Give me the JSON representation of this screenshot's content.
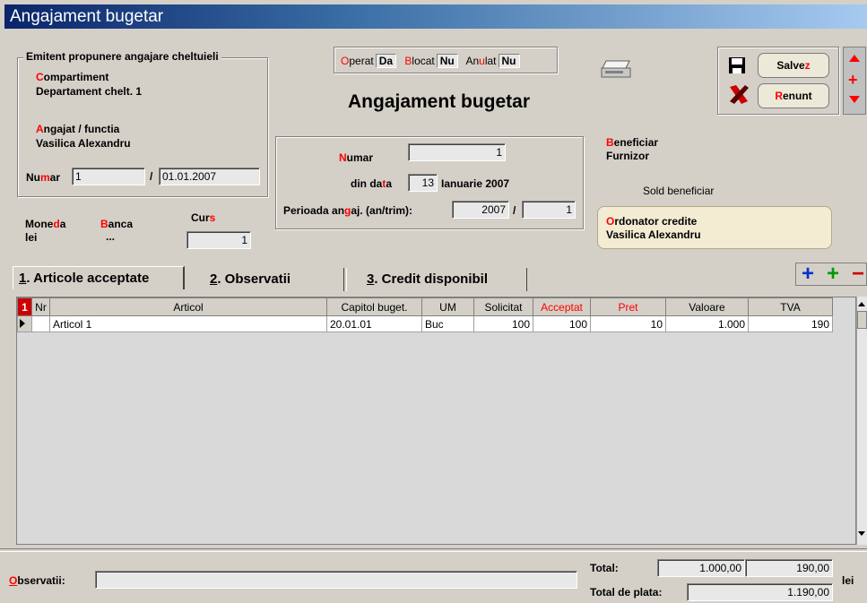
{
  "window": {
    "title": "Angajament bugetar"
  },
  "emitent": {
    "legend": "Emitent propunere angajare cheltuieli",
    "compartiment_label": [
      "C",
      "ompartiment"
    ],
    "compartiment_value": "Departament chelt. 1",
    "angajat_label": [
      "A",
      "ngajat / functia"
    ],
    "angajat_value": "Vasilica Alexandru",
    "numar_label": [
      "Nu",
      "m",
      "ar"
    ],
    "numar_value": "1",
    "data_value": "01.01.2007"
  },
  "moneda": {
    "label": [
      "Mone",
      "d",
      "a"
    ],
    "value": "lei"
  },
  "banca": {
    "label": [
      "B",
      "anca"
    ],
    "value": "..."
  },
  "curs": {
    "label": [
      "Cur",
      "s"
    ],
    "value": "1"
  },
  "status": {
    "operat": {
      "label": [
        "O",
        "perat"
      ],
      "value": "Da"
    },
    "blocat": {
      "label": [
        "B",
        "locat"
      ],
      "value": "Nu"
    },
    "anulat": {
      "label": [
        "An",
        "u",
        "lat"
      ],
      "value": "Nu"
    }
  },
  "header": {
    "title": "Angajament bugetar"
  },
  "document": {
    "numar_label": [
      "N",
      "umar"
    ],
    "numar_value": "1",
    "data_label": [
      "din da",
      "t",
      "a"
    ],
    "data_day": "13",
    "data_rest": "Ianuarie 2007",
    "perioada_label": [
      "Perioada an",
      "g",
      "aj. (an/trim):"
    ],
    "perioada_an": "2007",
    "perioada_trim": "1"
  },
  "beneficiar": {
    "label": [
      "B",
      "eneficiar"
    ],
    "furnizor": "Furnizor",
    "sold": "Sold beneficiar"
  },
  "ordonator": {
    "label": [
      "O",
      "rdonator credite"
    ],
    "value": "Vasilica Alexandru"
  },
  "buttons": {
    "save": [
      "Salve",
      "z"
    ],
    "cancel": [
      "R",
      "enunt"
    ]
  },
  "tabs": [
    {
      "num": "1",
      "label": ". Articole acceptate"
    },
    {
      "num": "2",
      "label": ". Observatii"
    },
    {
      "num": "3",
      "label": ". Credit disponibil"
    }
  ],
  "grid": {
    "corner": "1",
    "columns": [
      "Nr",
      "Articol",
      "Capitol buget.",
      "UM",
      "Solicitat",
      "Acceptat",
      "Pret",
      "Valoare",
      "TVA"
    ],
    "rows": [
      {
        "nr": "",
        "articol": "Articol 1",
        "capitol": "20.01.01",
        "um": "Buc",
        "solicitat": "100",
        "acceptat": "100",
        "pret": "10",
        "valoare": "1.000",
        "tva": "190"
      }
    ]
  },
  "footer": {
    "observatii_label": [
      "O",
      "bservatii:"
    ],
    "observatii_value": "",
    "total_label": "Total:",
    "total_valoare": "1.000,00",
    "total_tva": "190,00",
    "total_plata_label": "Total de plata:",
    "total_plata": "1.190,00",
    "currency": "lei"
  },
  "colors": {
    "accent_red": "#ff0000",
    "title_start": "#0a246a",
    "title_end": "#a6caf0",
    "ordonator_bg": "#f3ecd3"
  }
}
